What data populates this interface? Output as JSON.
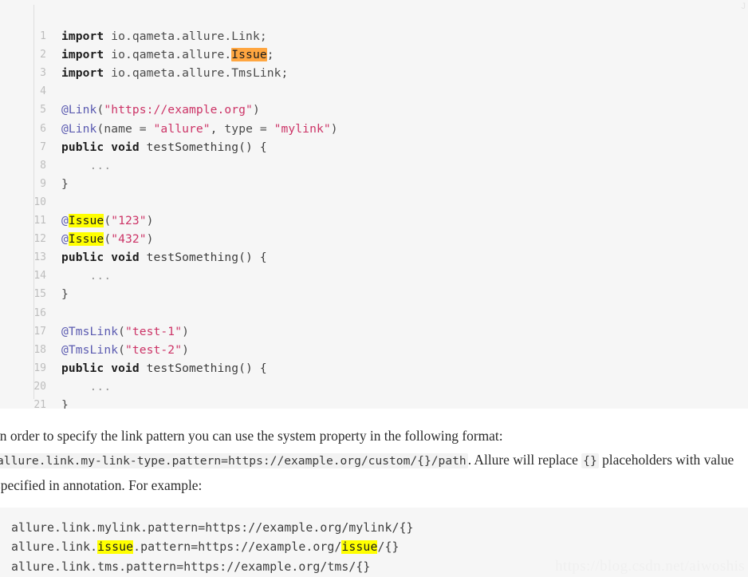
{
  "colors": {
    "code_background": "#f6f6f6",
    "page_background": "#ffffff",
    "gutter_number": "#bdbdbd",
    "keyword": "#1d1d1d",
    "annotation": "#5a5ab0",
    "string": "#cc3366",
    "plain_text": "#4a4a4a",
    "highlight_current_match": "#ffa640",
    "highlight_match": "#ffff00",
    "watermark": "#f0f0f0"
  },
  "code_block_top": {
    "language_tag": "J",
    "line_numbers": [
      "1",
      "2",
      "3",
      "4",
      "5",
      "6",
      "7",
      "8",
      "9",
      "10",
      "11",
      "12",
      "13",
      "14",
      "15",
      "16",
      "17",
      "18",
      "19",
      "20",
      "21"
    ],
    "lines": [
      "import io.qameta.allure.Link;",
      "import io.qameta.allure.Issue;",
      "import io.qameta.allure.TmsLink;",
      "",
      "@Link(\"https://example.org\")",
      "@Link(name = \"allure\", type = \"mylink\")",
      "public void testSomething() {",
      "    ...",
      "}",
      "",
      "@Issue(\"123\")",
      "@Issue(\"432\")",
      "public void testSomething() {",
      "    ...",
      "}",
      "",
      "@TmsLink(\"test-1\")",
      "@TmsLink(\"test-2\")",
      "public void testSomething() {",
      "    ...",
      "}"
    ],
    "tokens": {
      "l1": {
        "kw": "import",
        "plain": " io.qameta.allure.Link;"
      },
      "l2": {
        "kw": "import",
        "plain_a": " io.qameta.allure.",
        "hl": "Issue",
        "plain_b": ";"
      },
      "l3": {
        "kw": "import",
        "plain": " io.qameta.allure.TmsLink;"
      },
      "l5": {
        "anno": "@Link",
        "punct_open": "(",
        "str": "\"https://example.org\"",
        "punct_close": ")"
      },
      "l6": {
        "anno": "@Link",
        "punct_open": "(",
        "plain_name": "name = ",
        "str1": "\"allure\"",
        "comma": ", ",
        "plain_type": "type = ",
        "str2": "\"mylink\"",
        "punct_close": ")"
      },
      "l7": {
        "kw1": "public",
        "kw2": "void",
        "fn": " testSomething() {"
      },
      "l8": {
        "dots": "    ..."
      },
      "l9": {
        "punct": "}"
      },
      "l11": {
        "at": "@",
        "hl": "Issue",
        "punct_open": "(",
        "str": "\"123\"",
        "punct_close": ")"
      },
      "l12": {
        "at": "@",
        "hl": "Issue",
        "punct_open": "(",
        "str": "\"432\"",
        "punct_close": ")"
      },
      "l13": {
        "kw1": "public",
        "kw2": "void",
        "fn": " testSomething() {"
      },
      "l14": {
        "dots": "    ..."
      },
      "l15": {
        "punct": "}"
      },
      "l17": {
        "anno": "@TmsLink",
        "punct_open": "(",
        "str": "\"test-1\"",
        "punct_close": ")"
      },
      "l18": {
        "anno": "@TmsLink",
        "punct_open": "(",
        "str": "\"test-2\"",
        "punct_close": ")"
      },
      "l19": {
        "kw1": "public",
        "kw2": "void",
        "fn": " testSomething() {"
      },
      "l20": {
        "dots": "    ..."
      },
      "l21": {
        "punct": "}"
      }
    }
  },
  "paragraph": {
    "part1": "In order to specify the link pattern you can use the system property in the following format: ",
    "code1": "allure.link.my-link-type.pattern=https://example.org/custom/{}/path",
    "part2": ". Allure will replace ",
    "code2": "{}",
    "part3": " placeholders with value specified in annotation. For example:"
  },
  "code_block_bottom": {
    "lines": [
      "allure.link.mylink.pattern=https://example.org/mylink/{}",
      "allure.link.issue.pattern=https://example.org/issue/{}",
      "allure.link.tms.pattern=https://example.org/tms/{}"
    ],
    "tokens": {
      "b1": {
        "text": "allure.link.mylink.pattern=https://example.org/mylink/{}"
      },
      "b2": {
        "pre": "allure.link.",
        "hl1": "issue",
        "mid": ".pattern=https://example.org/",
        "hl2": "issue",
        "post": "/{}"
      },
      "b3": {
        "text": "allure.link.tms.pattern=https://example.org/tms/{}"
      }
    }
  },
  "watermark": {
    "text": "https://blog.csdn.net/aiwoshis"
  }
}
